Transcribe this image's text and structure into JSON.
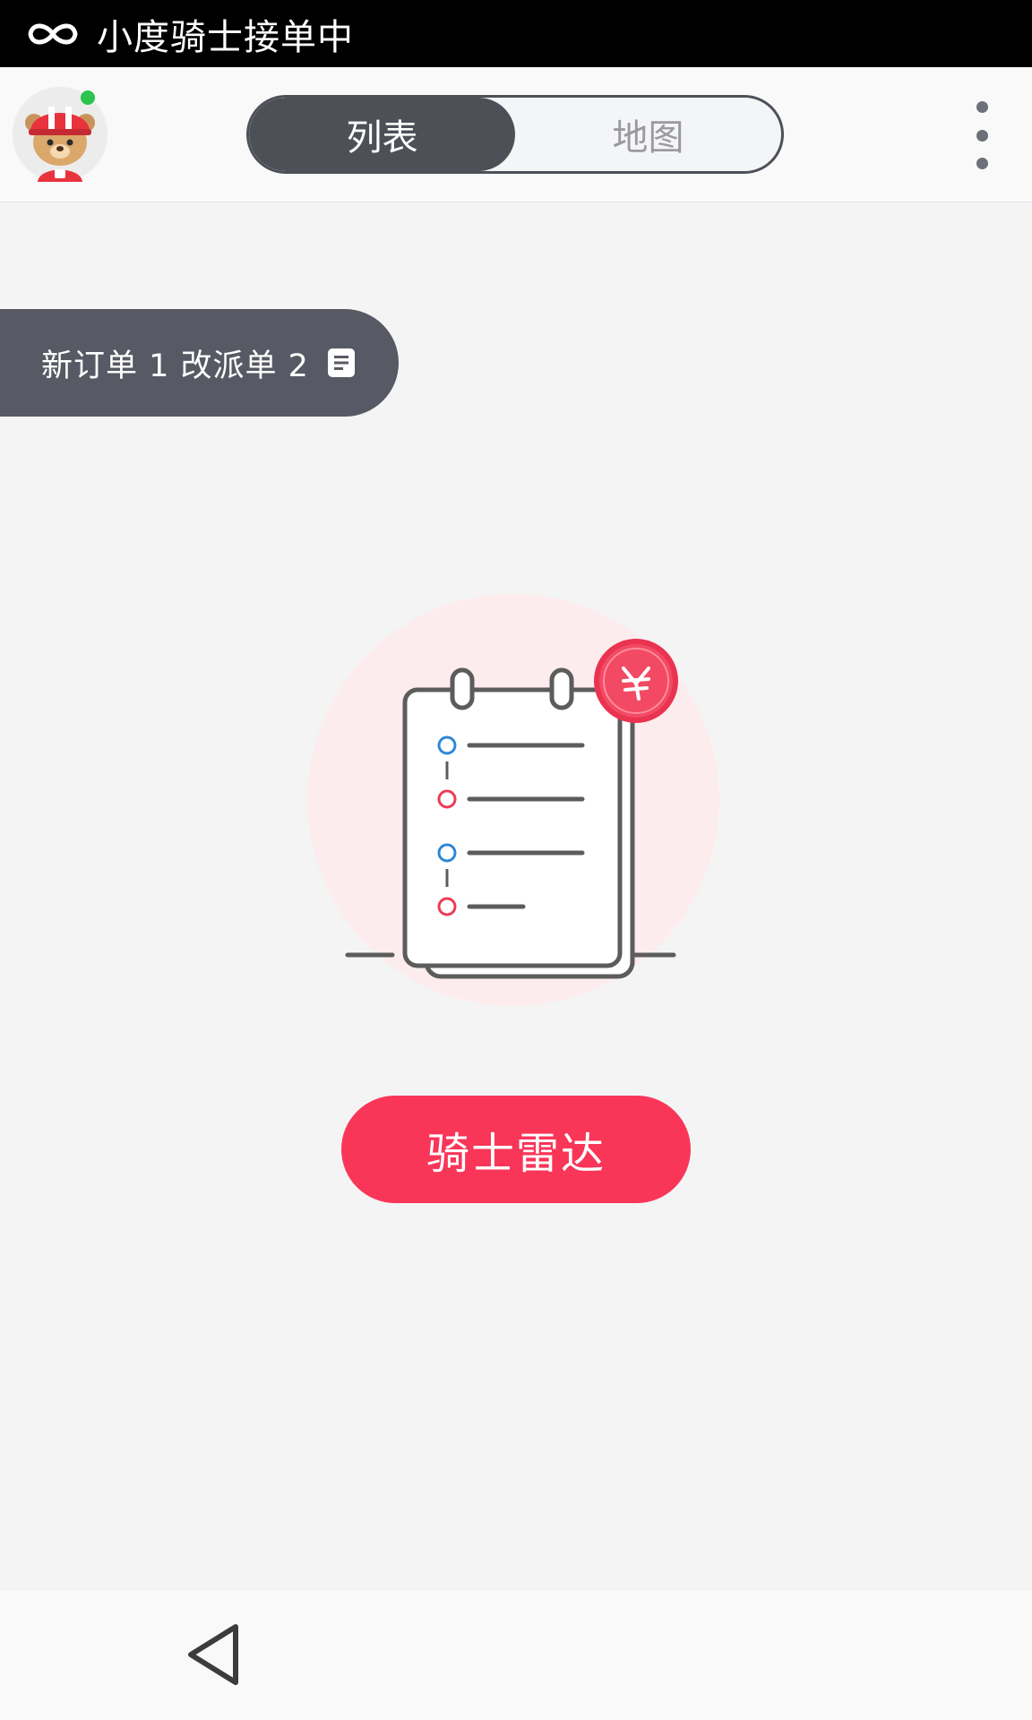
{
  "status_bar": {
    "app_icon": "infinity-icon",
    "text": "小度骑士接单中"
  },
  "header": {
    "avatar_icon": "rider-bear-avatar",
    "online_indicator_color": "#2ac44f",
    "tabs": [
      {
        "label": "列表",
        "active": true
      },
      {
        "label": "地图",
        "active": false
      }
    ],
    "more_icon": "more-vertical-icon"
  },
  "order_banner": {
    "text": "新订单 1  改派单 2",
    "icon": "document-icon"
  },
  "empty_state": {
    "illustration": "order-list-yuan-icon"
  },
  "primary_button": {
    "label": "骑士雷达"
  },
  "nav_bar": {
    "back_icon": "back-triangle-icon"
  },
  "colors": {
    "accent": "#f93658",
    "dark": "#4d5057",
    "background": "#f4f4f5"
  }
}
